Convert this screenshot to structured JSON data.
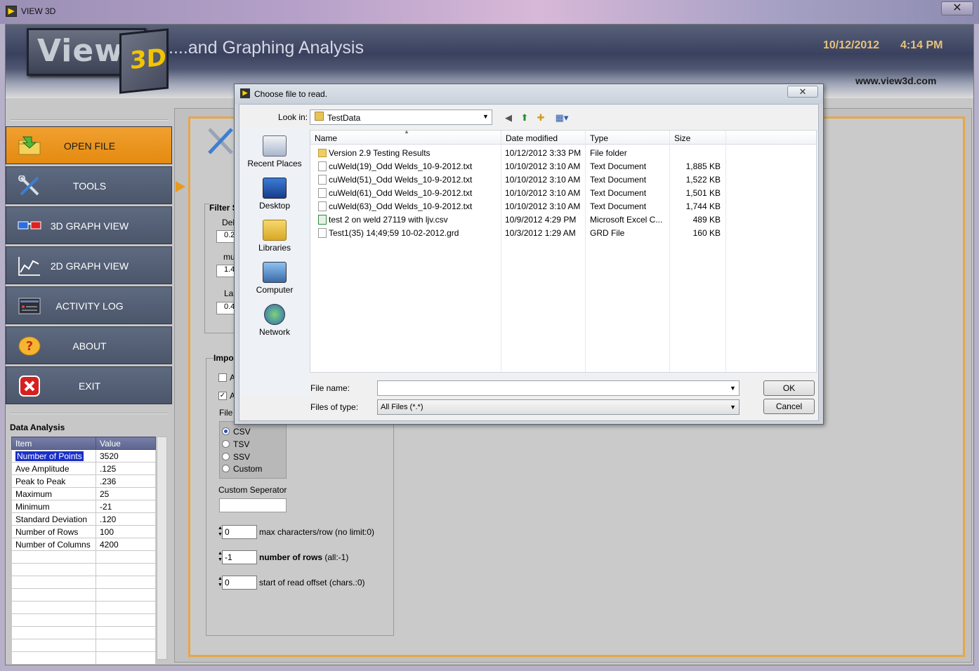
{
  "window": {
    "title": "VIEW 3D",
    "close": "✕"
  },
  "header": {
    "logo_view": "View",
    "logo_3d": "3D",
    "tagline": "....and Graphing Analysis",
    "date": "10/12/2012",
    "time": "4:14 PM",
    "url": "www.view3d.com"
  },
  "menu": [
    {
      "label": "OPEN FILE",
      "icon": "open-file-icon",
      "active": true
    },
    {
      "label": "TOOLS",
      "icon": "tools-icon"
    },
    {
      "label": "3D GRAPH VIEW",
      "icon": "3d-glasses-icon"
    },
    {
      "label": "2D GRAPH VIEW",
      "icon": "line-graph-icon"
    },
    {
      "label": "ACTIVITY LOG",
      "icon": "log-icon"
    },
    {
      "label": "ABOUT",
      "icon": "question-icon"
    },
    {
      "label": "EXIT",
      "icon": "exit-icon"
    }
  ],
  "data_analysis": {
    "title": "Data Analysis",
    "headers": [
      "Item",
      "Value"
    ],
    "rows": [
      [
        "Number of Points",
        "3520"
      ],
      [
        "Ave Amplitude",
        ".125"
      ],
      [
        "Peak to Peak",
        ".236"
      ],
      [
        "Maximum",
        "25"
      ],
      [
        "Minimum",
        "-21"
      ],
      [
        "Standard Deviation",
        ".120"
      ],
      [
        "Number of Rows",
        "100"
      ],
      [
        "Number of Columns",
        "4200"
      ]
    ]
  },
  "panel": {
    "filter_label": "Filter S",
    "filter_fields": [
      {
        "label": "Del",
        "value": "0.2"
      },
      {
        "label": "mu",
        "value": "1.4"
      },
      {
        "label": "La",
        "value": "0.4"
      }
    ],
    "import_label": "Impo",
    "checkbox1_label": "A",
    "checkbox2_label": "A",
    "file_label": "File",
    "radio_options": [
      "CSV",
      "TSV",
      "SSV",
      "Custom"
    ],
    "custom_sep_label": "Custom Seperator",
    "max_chars": {
      "value": "0",
      "label": "max characters/row  (no limit:0)"
    },
    "num_rows": {
      "value": "-1",
      "label_bold": "number of rows",
      "label": " (all:-1)"
    },
    "read_offset": {
      "value": "0",
      "label": "start of read offset (chars.:0)"
    }
  },
  "dialog": {
    "title": "Choose file to read.",
    "look_in_label": "Look in:",
    "look_in_value": "TestData",
    "places": [
      "Recent Places",
      "Desktop",
      "Libraries",
      "Computer",
      "Network"
    ],
    "columns": [
      "Name",
      "Date modified",
      "Type",
      "Size"
    ],
    "files": [
      {
        "name": "Version 2.9 Testing Results",
        "date": "10/12/2012 3:33 PM",
        "type": "File folder",
        "size": "",
        "kind": "folder"
      },
      {
        "name": "cuWeld(19)_Odd Welds_10-9-2012.txt",
        "date": "10/10/2012 3:10 AM",
        "type": "Text Document",
        "size": "1,885 KB",
        "kind": "txt"
      },
      {
        "name": "cuWeld(51)_Odd Welds_10-9-2012.txt",
        "date": "10/10/2012 3:10 AM",
        "type": "Text Document",
        "size": "1,522 KB",
        "kind": "txt"
      },
      {
        "name": "cuWeld(61)_Odd Welds_10-9-2012.txt",
        "date": "10/10/2012 3:10 AM",
        "type": "Text Document",
        "size": "1,501 KB",
        "kind": "txt"
      },
      {
        "name": "cuWeld(63)_Odd Welds_10-9-2012.txt",
        "date": "10/10/2012 3:10 AM",
        "type": "Text Document",
        "size": "1,744 KB",
        "kind": "txt"
      },
      {
        "name": "test 2 on weld 27119 with ljv.csv",
        "date": "10/9/2012 4:29 PM",
        "type": "Microsoft Excel C...",
        "size": "489 KB",
        "kind": "xls"
      },
      {
        "name": "Test1(35) 14;49;59  10-02-2012.grd",
        "date": "10/3/2012 1:29 AM",
        "type": "GRD File",
        "size": "160 KB",
        "kind": "txt"
      }
    ],
    "file_name_label": "File name:",
    "file_name_value": "",
    "file_type_label": "Files of type:",
    "file_type_value": "All Files (*.*)",
    "ok_label": "OK",
    "cancel_label": "Cancel"
  },
  "colors": {
    "accent": "#e8a646",
    "menu": "#55607a",
    "header_text": "#e7c27a"
  }
}
